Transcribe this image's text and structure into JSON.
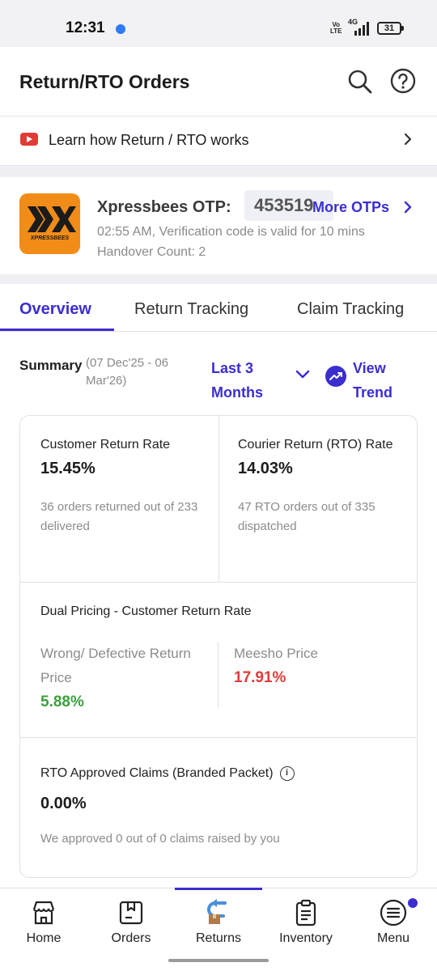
{
  "status": {
    "time": "12:31",
    "volte_top": "Vo",
    "volte_bottom": "LTE",
    "network": "4G",
    "battery": "31"
  },
  "header": {
    "title": "Return/RTO Orders",
    "icons": [
      "search-icon",
      "help-icon"
    ]
  },
  "learn_banner": {
    "label": "Learn how Return / RTO works"
  },
  "otp": {
    "logo_text": "XPRESSBEES",
    "courier": "Xpressbees OTP:",
    "code": "453519",
    "more_label": "More OTPs",
    "detail": "02:55 AM, Verification code is valid for 10 mins",
    "handover": "Handover Count: 2"
  },
  "tabs": [
    {
      "label": "Overview",
      "active": true
    },
    {
      "label": "Return Tracking",
      "active": false
    },
    {
      "label": "Claim Tracking",
      "active": false
    }
  ],
  "summary": {
    "label": "Summary",
    "range": "(07 Dec'25 - 06 Mar'26)",
    "period": "Last 3 Months",
    "trend_label": "View Trend"
  },
  "metrics": {
    "customer_return": {
      "title": "Customer Return Rate",
      "value": "15.45%",
      "note": "36 orders returned out of 233 delivered"
    },
    "courier_return": {
      "title": "Courier Return (RTO) Rate",
      "value": "14.03%",
      "note": "47 RTO orders out of 335 dispatched"
    },
    "dual_pricing": {
      "title": "Dual Pricing - Customer Return Rate",
      "wrong_label": "Wrong/ Defective Return Price",
      "wrong_value": "5.88%",
      "meesho_label": "Meesho Price",
      "meesho_value": "17.91%"
    },
    "claims": {
      "title": "RTO Approved Claims (Branded Packet)",
      "info": "i",
      "value": "0.00%",
      "note": "We approved 0 out of 0 claims raised by you"
    }
  },
  "nav": [
    {
      "label": "Home",
      "icon": "store-icon"
    },
    {
      "label": "Orders",
      "icon": "orders-icon"
    },
    {
      "label": "Returns",
      "icon": "returns-icon",
      "active": true
    },
    {
      "label": "Inventory",
      "icon": "inventory-icon"
    },
    {
      "label": "Menu",
      "icon": "menu-icon"
    }
  ],
  "colors": {
    "accent": "#3b2ecf",
    "positive": "#3aa13a",
    "negative": "#e03b3b",
    "logo": "#f28c18"
  }
}
